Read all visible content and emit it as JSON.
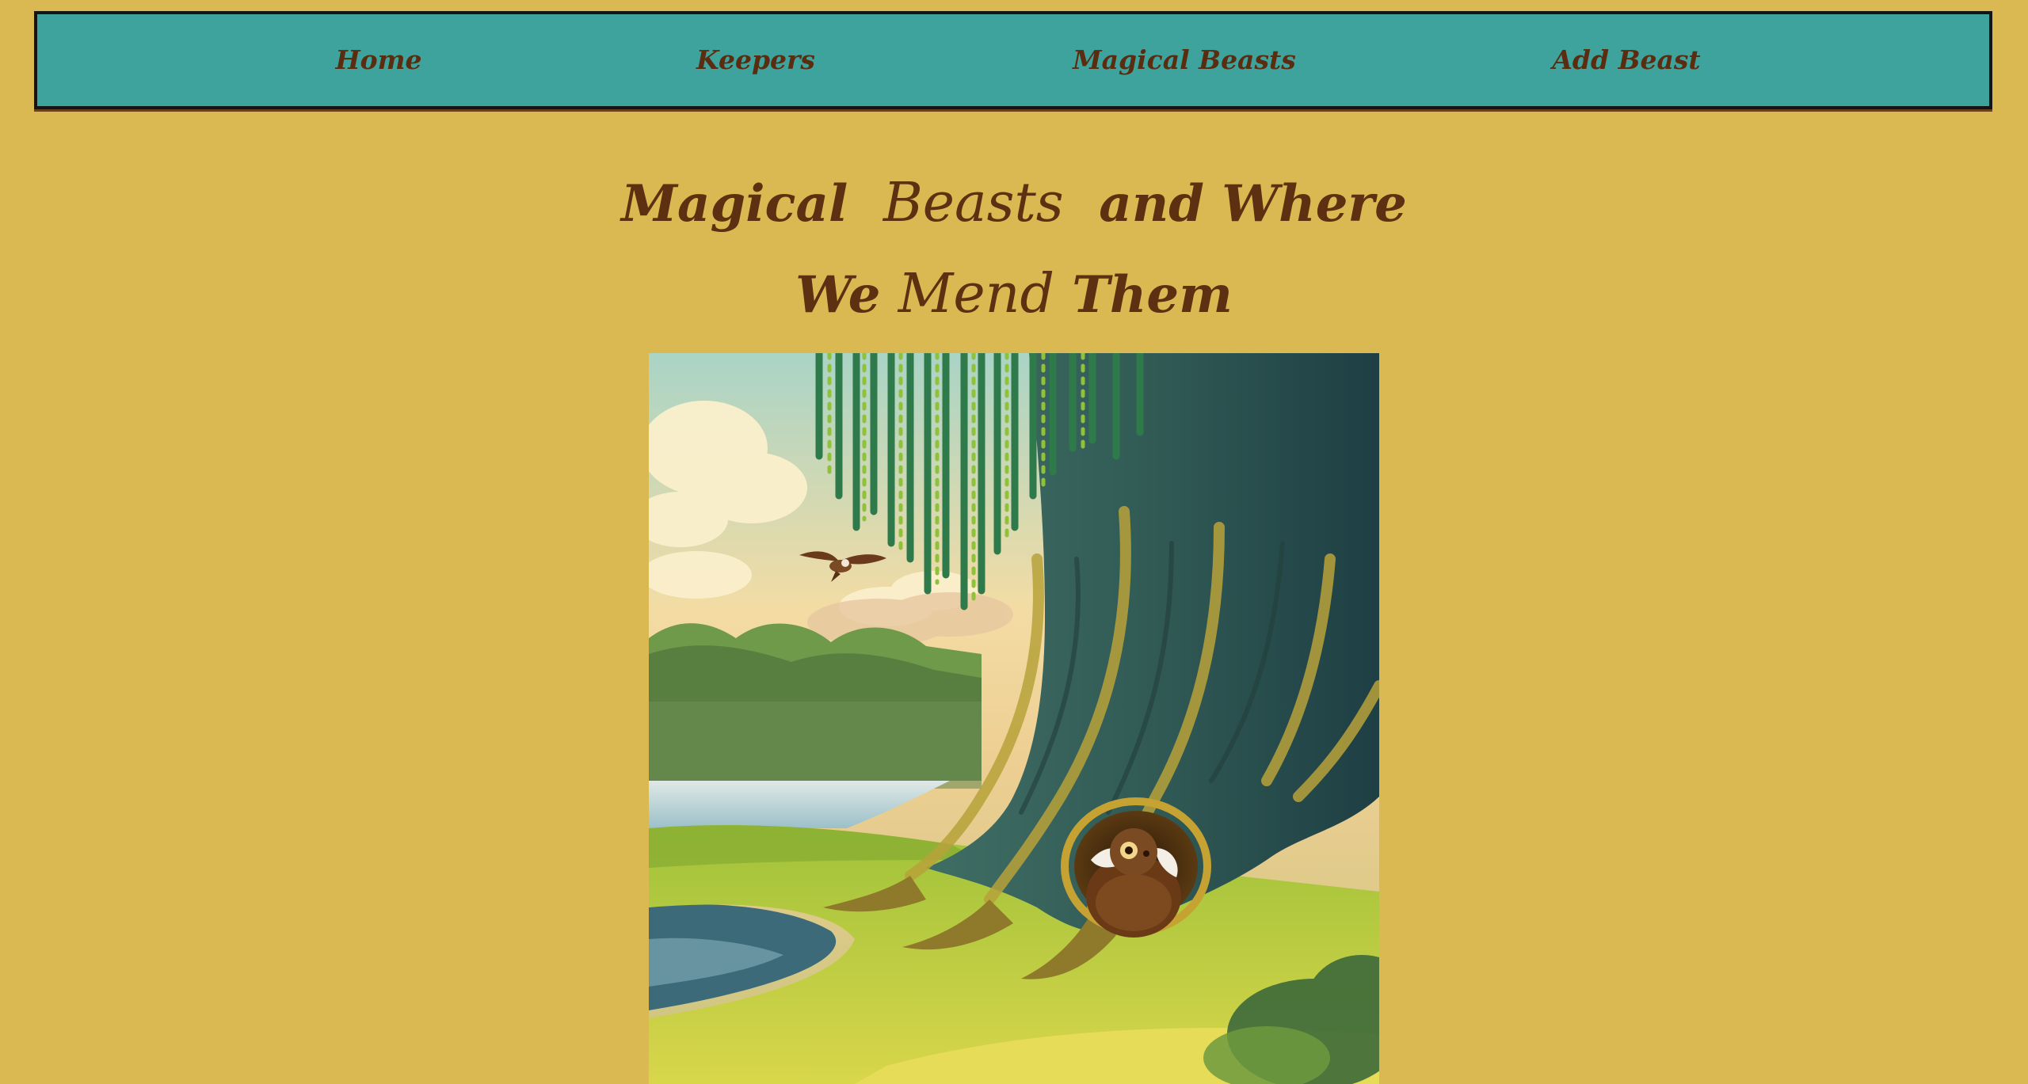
{
  "nav": {
    "items": [
      {
        "label": "Home"
      },
      {
        "label": "Keepers"
      },
      {
        "label": "Magical Beasts"
      },
      {
        "label": "Add Beast"
      }
    ]
  },
  "heading": {
    "line1": {
      "part1": "Magical",
      "part2": "Beasts",
      "part3": "and Where"
    },
    "line2": {
      "part1": "We",
      "part2": "Mend",
      "part3": "Them"
    }
  },
  "hero": {
    "image_name": "willow-tree-beast-illustration-image",
    "icons": [
      "bird-icon",
      "beast-creature-icon"
    ]
  },
  "colors": {
    "page_background": "#dab852",
    "nav_background": "#3ea39d",
    "nav_border": "#141414",
    "text_brown": "#5e2f10"
  }
}
